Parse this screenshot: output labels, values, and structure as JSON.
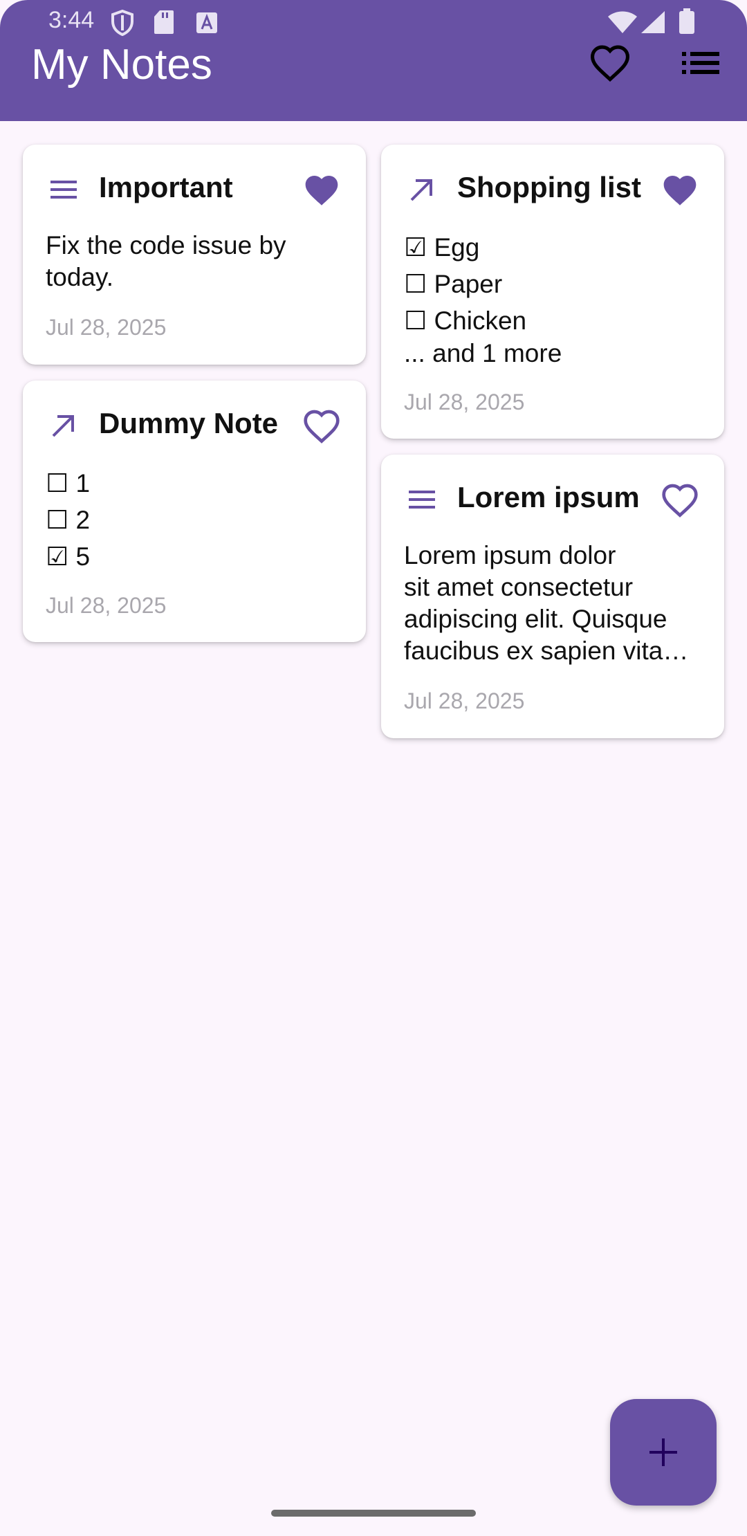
{
  "status_bar": {
    "time": "3:44",
    "icons": [
      "shield-icon",
      "sd-card-icon",
      "font-a-icon",
      "wifi-icon",
      "cell-signal-icon",
      "battery-icon"
    ]
  },
  "app_bar": {
    "title": "My Notes",
    "actions": [
      "favorites-heart-icon",
      "list-view-icon"
    ],
    "color": "#6851a4"
  },
  "notes": [
    {
      "title": "Important",
      "type_icon": "text-lines-icon",
      "favorite": true,
      "body": [
        "Fix the code issue by",
        "today."
      ],
      "date": "Jul 28, 2025"
    },
    {
      "title": "Dummy Note",
      "type_icon": "arrow-up-right-icon",
      "favorite": false,
      "checklist": [
        {
          "checked": false,
          "text": "1",
          "label": "☐ 1"
        },
        {
          "checked": false,
          "text": "2",
          "label": "☐ 2"
        },
        {
          "checked": true,
          "text": "5",
          "label": "☑ 5"
        }
      ],
      "date": "Jul 28, 2025"
    },
    {
      "title": "Shopping list",
      "type_icon": "arrow-up-right-icon",
      "favorite": true,
      "checklist": [
        {
          "checked": true,
          "text": "Egg",
          "label": "☑ Egg"
        },
        {
          "checked": false,
          "text": "Paper",
          "label": "☐ Paper"
        },
        {
          "checked": false,
          "text": "Chicken",
          "label": "☐ Chicken"
        }
      ],
      "more": "... and 1 more",
      "date": "Jul 28, 2025"
    },
    {
      "title": "Lorem ipsum",
      "type_icon": "text-lines-icon",
      "favorite": false,
      "body": [
        "Lorem ipsum dolor",
        "sit amet consectetur",
        "adipiscing elit. Quisque",
        "faucibus ex sapien vita…"
      ],
      "date": "Jul 28, 2025"
    }
  ],
  "fab": {
    "icon": "plus-icon"
  },
  "colors": {
    "accent": "#6851a4",
    "background": "#fcf5fd",
    "date_text": "#a9a7ad"
  }
}
